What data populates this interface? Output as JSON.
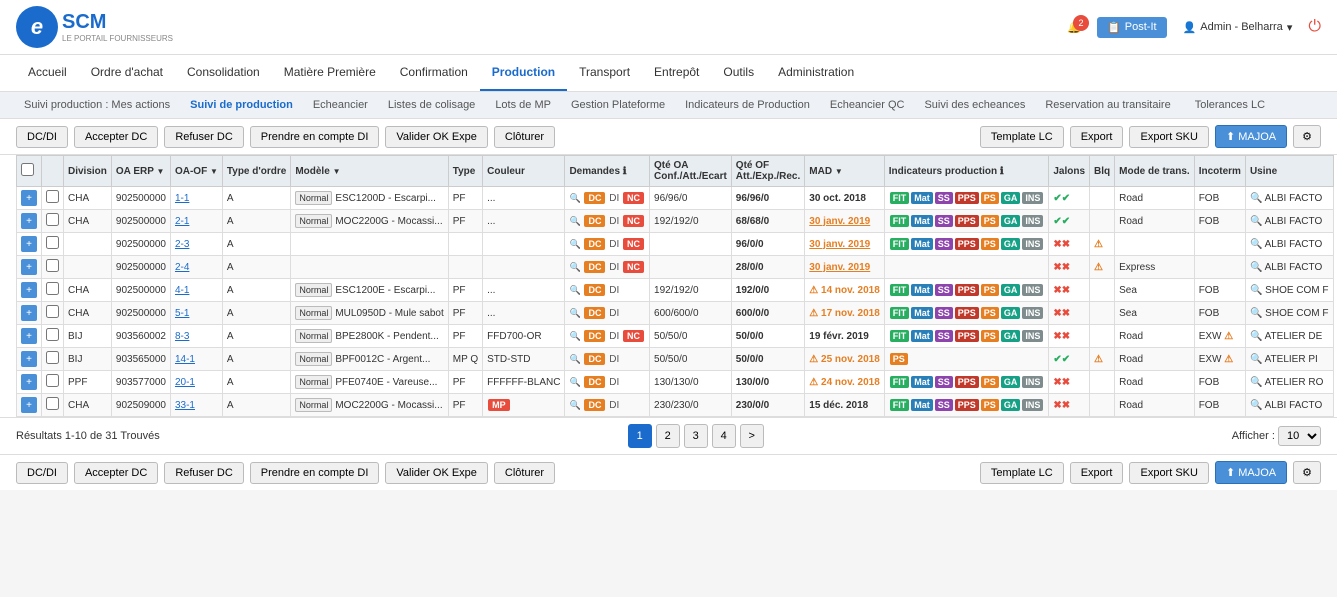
{
  "header": {
    "logo_letter": "e",
    "logo_text": "SCM",
    "logo_sub": "LE PORTAIL FOURNISSEURS",
    "notif_count": "2",
    "postit_label": "Post-It",
    "admin_name": "Admin - Belharra",
    "bell_icon": "🔔",
    "postit_icon": "📋",
    "user_icon": "👤",
    "power_icon": "⏻"
  },
  "nav": {
    "items": [
      {
        "label": "Accueil",
        "active": false
      },
      {
        "label": "Ordre d'achat",
        "active": false
      },
      {
        "label": "Consolidation",
        "active": false
      },
      {
        "label": "Matière Première",
        "active": false
      },
      {
        "label": "Confirmation",
        "active": false
      },
      {
        "label": "Production",
        "active": true
      },
      {
        "label": "Transport",
        "active": false
      },
      {
        "label": "Entrepôt",
        "active": false
      },
      {
        "label": "Outils",
        "active": false
      },
      {
        "label": "Administration",
        "active": false
      }
    ]
  },
  "subnav": {
    "items": [
      {
        "label": "Suivi production : Mes actions",
        "active": false
      },
      {
        "label": "Suivi de production",
        "active": true
      },
      {
        "label": "Echeancier",
        "active": false
      },
      {
        "label": "Listes de colisage",
        "active": false
      },
      {
        "label": "Lots de MP",
        "active": false
      },
      {
        "label": "Gestion Plateforme",
        "active": false
      },
      {
        "label": "Indicateurs de Production",
        "active": false
      },
      {
        "label": "Echeancier QC",
        "active": false
      },
      {
        "label": "Suivi des echeances",
        "active": false
      },
      {
        "label": "Reservation au transitaire",
        "active": false
      },
      {
        "label": "Tolerances LC",
        "active": false
      }
    ]
  },
  "toolbar": {
    "btn_dcddi": "DC/DI",
    "btn_acceptdc": "Accepter DC",
    "btn_refuserdc": "Refuser DC",
    "btn_prendre": "Prendre en compte DI",
    "btn_valider": "Valider OK Expe",
    "btn_cloture": "Clôturer",
    "btn_template": "Template LC",
    "btn_export": "Export",
    "btn_exportsku": "Export SKU",
    "btn_majoa": "⬆ MAJOA",
    "btn_settings": "⚙"
  },
  "table": {
    "columns": [
      "",
      "",
      "Division",
      "OA ERP",
      "OA-OF",
      "Type d'ordre",
      "Modèle",
      "Type",
      "Couleur",
      "Demandes",
      "Qté OA Conf./Att./Ecart",
      "Qté OF Att./Exp./Rec.",
      "MAD",
      "Indicateurs production",
      "Jalons",
      "Blq",
      "Mode de trans.",
      "Incoterm",
      "Usine"
    ],
    "rows": [
      {
        "expand": "+",
        "check": false,
        "division": "CHA",
        "oaerp": "902500000",
        "oaof": "1-1",
        "type_ordre": "A",
        "modele": "ESC1200D - Escarpi...",
        "type": "PF",
        "couleur": "...",
        "demandes": "DC DI NC",
        "qte_oa": "96/96/0",
        "qte_of": "96/96/0",
        "mad": "30 oct. 2018",
        "mad_warn": false,
        "mad_style": "bold",
        "ind": [
          "FIT",
          "Mat",
          "SS",
          "PPS",
          "PS",
          "GA",
          "INS"
        ],
        "jalons_ok": true,
        "blq": false,
        "mode_trans": "Road",
        "incoterm": "FOB",
        "usine": "ALBI FACTO"
      },
      {
        "expand": "+",
        "check": false,
        "division": "CHA",
        "oaerp": "902500000",
        "oaof": "2-1",
        "type_ordre": "A",
        "modele": "MOC2200G - Mocassi...",
        "type": "PF",
        "couleur": "...",
        "demandes": "DC DI NC",
        "qte_oa": "192/192/0",
        "qte_of": "68/68/0",
        "mad": "30 janv. 2019",
        "mad_warn": false,
        "mad_style": "bold underline",
        "ind": [
          "FIT",
          "Mat",
          "SS",
          "PPS",
          "PS",
          "GA",
          "INS"
        ],
        "jalons_ok": true,
        "blq": false,
        "mode_trans": "Road",
        "incoterm": "FOB",
        "usine": "ALBI FACTO"
      },
      {
        "expand": "+",
        "check": false,
        "division": "",
        "oaerp": "902500000",
        "oaof": "2-3",
        "type_ordre": "A",
        "modele": "",
        "type": "",
        "couleur": "",
        "demandes": "DC DI NC",
        "qte_oa": "",
        "qte_of": "96/0/0",
        "mad": "30 janv. 2019",
        "mad_warn": false,
        "mad_style": "bold underline",
        "ind": [
          "FIT",
          "Mat",
          "SS",
          "PPS",
          "PS",
          "GA",
          "INS"
        ],
        "jalons_ok": false,
        "blq": true,
        "mode_trans": "",
        "incoterm": "",
        "usine": "ALBI FACTO"
      },
      {
        "expand": "+",
        "check": false,
        "division": "",
        "oaerp": "902500000",
        "oaof": "2-4",
        "type_ordre": "A",
        "modele": "",
        "type": "",
        "couleur": "",
        "demandes": "DC DI NC",
        "qte_oa": "",
        "qte_of": "28/0/0",
        "mad": "30 janv. 2019",
        "mad_warn": false,
        "mad_style": "bold underline",
        "ind": [],
        "jalons_ok": false,
        "blq": true,
        "mode_trans": "Express",
        "incoterm": "",
        "usine": "ALBI FACTO"
      },
      {
        "expand": "+",
        "check": false,
        "division": "CHA",
        "oaerp": "902500000",
        "oaof": "4-1",
        "type_ordre": "A",
        "modele": "ESC1200E - Escarpi...",
        "type": "PF",
        "couleur": "...",
        "demandes": "DC DI",
        "qte_oa": "192/192/0",
        "qte_of": "192/0/0",
        "mad": "14 nov. 2018",
        "mad_warn": true,
        "mad_style": "bold",
        "ind": [
          "FIT",
          "Mat",
          "SS",
          "PPS",
          "PS",
          "GA",
          "INS"
        ],
        "jalons_ok": false,
        "blq": false,
        "mode_trans": "Sea",
        "incoterm": "FOB",
        "usine": "SHOE COM F"
      },
      {
        "expand": "+",
        "check": false,
        "division": "CHA",
        "oaerp": "902500000",
        "oaof": "5-1",
        "type_ordre": "A",
        "modele": "MUL0950D - Mule sabot",
        "type": "PF",
        "couleur": "...",
        "demandes": "DC DI",
        "qte_oa": "600/600/0",
        "qte_of": "600/0/0",
        "mad": "17 nov. 2018",
        "mad_warn": true,
        "mad_style": "bold",
        "ind": [
          "FIT",
          "Mat",
          "SS",
          "PPS",
          "PS",
          "GA",
          "INS"
        ],
        "jalons_ok": false,
        "blq": false,
        "mode_trans": "Sea",
        "incoterm": "FOB",
        "usine": "SHOE COM F"
      },
      {
        "expand": "+",
        "check": false,
        "division": "BIJ",
        "oaerp": "903560002",
        "oaof": "8-3",
        "type_ordre": "A",
        "modele": "BPE2800K - Pendent...",
        "type": "PF",
        "couleur": "FFD700-OR",
        "demandes": "DC DI NC",
        "qte_oa": "50/50/0",
        "qte_of": "50/0/0",
        "mad": "19 févr. 2019",
        "mad_warn": false,
        "mad_style": "bold",
        "ind": [
          "FIT",
          "Mat",
          "SS",
          "PPS",
          "PS",
          "GA",
          "INS"
        ],
        "jalons_ok": false,
        "blq": false,
        "mode_trans": "Road",
        "incoterm": "EXW",
        "usine": "ATELIER DE"
      },
      {
        "expand": "+",
        "check": false,
        "division": "BIJ",
        "oaerp": "903565000",
        "oaof": "14-1",
        "type_ordre": "A",
        "modele": "BPF0012C - Argent...",
        "type": "MP Q",
        "couleur": "STD-STD",
        "demandes": "DC DI",
        "qte_oa": "50/50/0",
        "qte_of": "50/0/0",
        "mad": "25 nov. 2018",
        "mad_warn": true,
        "mad_style": "bold",
        "ind": [
          "PS"
        ],
        "jalons_ok": true,
        "blq": true,
        "mode_trans": "Road",
        "incoterm": "EXW",
        "usine": "ATELIER PI"
      },
      {
        "expand": "+",
        "check": false,
        "division": "PPF",
        "oaerp": "903577000",
        "oaof": "20-1",
        "type_ordre": "A",
        "modele": "PFE0740E - Vareuse...",
        "type": "PF",
        "couleur": "FFFFFF-BLANC",
        "demandes": "DC DI",
        "qte_oa": "130/130/0",
        "qte_of": "130/0/0",
        "mad": "24 nov. 2018",
        "mad_warn": true,
        "mad_style": "bold",
        "ind": [
          "FIT",
          "Mat",
          "SS",
          "PPS",
          "PS",
          "GA",
          "INS"
        ],
        "jalons_ok": false,
        "blq": false,
        "mode_trans": "Road",
        "incoterm": "FOB",
        "usine": "ATELIER RO"
      },
      {
        "expand": "+",
        "check": false,
        "division": "CHA",
        "oaerp": "902509000",
        "oaof": "33-1",
        "type_ordre": "A",
        "modele": "MOC2200G - Mocassi...",
        "type": "PF",
        "couleur": "MP",
        "demandes": "DC DI",
        "qte_oa": "230/230/0",
        "qte_of": "230/0/0",
        "mad": "15 déc. 2018",
        "mad_warn": false,
        "mad_style": "bold",
        "ind": [
          "FIT",
          "Mat",
          "SS",
          "PPS",
          "PS",
          "GA",
          "INS"
        ],
        "jalons_ok": false,
        "blq": false,
        "mode_trans": "Road",
        "incoterm": "FOB",
        "usine": "ALBI FACTO"
      }
    ]
  },
  "pagination": {
    "result_text": "Résultats 1-10 de 31 Trouvés",
    "pages": [
      "1",
      "2",
      "3",
      "4",
      ">"
    ],
    "current": "1",
    "show_label": "Afficher :",
    "show_value": "10"
  }
}
